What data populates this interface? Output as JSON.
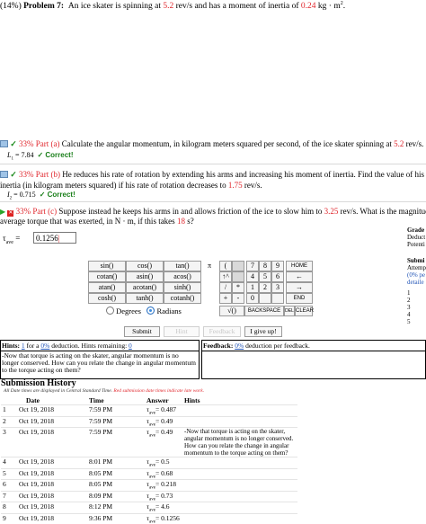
{
  "problem": {
    "percent": "(14%)",
    "title": "Problem 7:",
    "text_before_speed": "An ice skater is spinning at ",
    "speed": "5.2",
    "speed_unit": " rev/s and has a moment of inertia of ",
    "inertia": "0.24",
    "inertia_unit": " kg · m",
    "inertia_exp": "2",
    "tail": "."
  },
  "part_a": {
    "label": "33% Part (a)",
    "text": "Calculate the angular momentum, in kilogram meters squared per second, of the ice skater spinning at ",
    "value": "5.2",
    "unit": " rev/s.",
    "answer_var": "L",
    "answer_sub": "1",
    "answer_val": " = 7.84",
    "correct": "✓ Correct!"
  },
  "part_b": {
    "label": "33% Part (b)",
    "text": "He reduces his rate of rotation by extending his arms and increasing his moment of inertia. Find the value of his mo",
    "line2a": "inertia (in kilogram meters squared) if his rate of rotation decreases to ",
    "value": "1.75",
    "unit": " rev/s.",
    "answer_var": "I",
    "answer_sub": "2",
    "answer_val": " = 0.715",
    "correct": "✓ Correct!"
  },
  "part_c": {
    "label": "33% Part (c)",
    "text1": "Suppose instead he keeps his arms in and allows friction of the ice to slow him to ",
    "value1": "3.25",
    "text2": " rev/s. What is the magnitude",
    "line2a": "average torque that was exerted, in N · m, if this takes ",
    "value2": "18",
    "line2b": " s?",
    "input_label": "τ",
    "input_sub": "ave",
    "input_eq": " = ",
    "input_value": "0.1256"
  },
  "sidebar": {
    "grade": "Grade",
    "deduct": "Deduct",
    "potential": "Potenti",
    "submi": "Submi",
    "attempt": "Attemp",
    "pct": "(0% pe",
    "detail": "detaile",
    "nums": [
      "1",
      "2",
      "3",
      "4",
      "5"
    ]
  },
  "calc": {
    "funcs": [
      [
        "sin()",
        "cos()",
        "tan()"
      ],
      [
        "cotan()",
        "asin()",
        "acos()"
      ],
      [
        "atan()",
        "acotan()",
        "sinh()"
      ],
      [
        "cosh()",
        "tanh()",
        "cotanh()"
      ]
    ],
    "sym": [
      [
        "π",
        "("
      ],
      [
        "",
        "↑^"
      ],
      [
        "",
        "/"
      ],
      [
        "",
        "+"
      ]
    ],
    "col_b": [
      "",
      "",
      "*",
      "-"
    ],
    "nums": [
      [
        "7",
        "8",
        "9"
      ],
      [
        "4",
        "5",
        "6"
      ],
      [
        "1",
        "2",
        "3"
      ],
      [
        "0",
        "",
        ""
      ]
    ],
    "side": [
      "HOME",
      "←",
      "→",
      "END"
    ],
    "sqrt": "√()",
    "backspace": "BACKSPACE",
    "del": "DEL",
    "clear": "CLEAR",
    "degrees": "Degrees",
    "radians": "Radians"
  },
  "actions": {
    "submit": "Submit",
    "hint": "Hint",
    "feedback": "Feedback",
    "give_up": "I give up!"
  },
  "hints": {
    "label": "Hints:",
    "count": "1",
    "for_a": " for a ",
    "pct": "0%",
    "deduction": " deduction. Hints remaining: ",
    "remaining": "0",
    "message": "-Now that torque is acting on the skater, angular momentum is no longer conserved. How can you relate the change in angular momentum to the torque acting on them?"
  },
  "feedback": {
    "label": "Feedback:",
    "pct": "0%",
    "text": " deduction per feedback."
  },
  "history": {
    "title": "Submission History",
    "note_a": "All Date times are displayed in Central Standard Time. ",
    "note_b": "Red submission date times indicate late work.",
    "columns": [
      "",
      "Date",
      "Time",
      "Answer",
      "Hints"
    ],
    "rows": [
      {
        "n": "1",
        "date": "Oct 19, 2018",
        "time": "7:59 PM",
        "ans": "= 0.487",
        "hint": ""
      },
      {
        "n": "2",
        "date": "Oct 19, 2018",
        "time": "7:59 PM",
        "ans": "= 0.49",
        "hint": ""
      },
      {
        "n": "3",
        "date": "Oct 19, 2018",
        "time": "7:59 PM",
        "ans": "= 0.49",
        "hint": "-Now that torque is acting on the skater, angular momentum is no longer conserved. How can you relate the change in angular momentum to the torque acting on them?"
      },
      {
        "n": "4",
        "date": "Oct 19, 2018",
        "time": "8:01 PM",
        "ans": "= 0.5",
        "hint": ""
      },
      {
        "n": "5",
        "date": "Oct 19, 2018",
        "time": "8:05 PM",
        "ans": "= 0.68",
        "hint": ""
      },
      {
        "n": "6",
        "date": "Oct 19, 2018",
        "time": "8:05 PM",
        "ans": "= 0.218",
        "hint": ""
      },
      {
        "n": "7",
        "date": "Oct 19, 2018",
        "time": "8:09 PM",
        "ans": "= 0.73",
        "hint": ""
      },
      {
        "n": "8",
        "date": "Oct 19, 2018",
        "time": "8:12 PM",
        "ans": "= 4.6",
        "hint": ""
      },
      {
        "n": "9",
        "date": "Oct 19, 2018",
        "time": "9:36 PM",
        "ans": "= 0.1256",
        "hint": ""
      }
    ]
  }
}
